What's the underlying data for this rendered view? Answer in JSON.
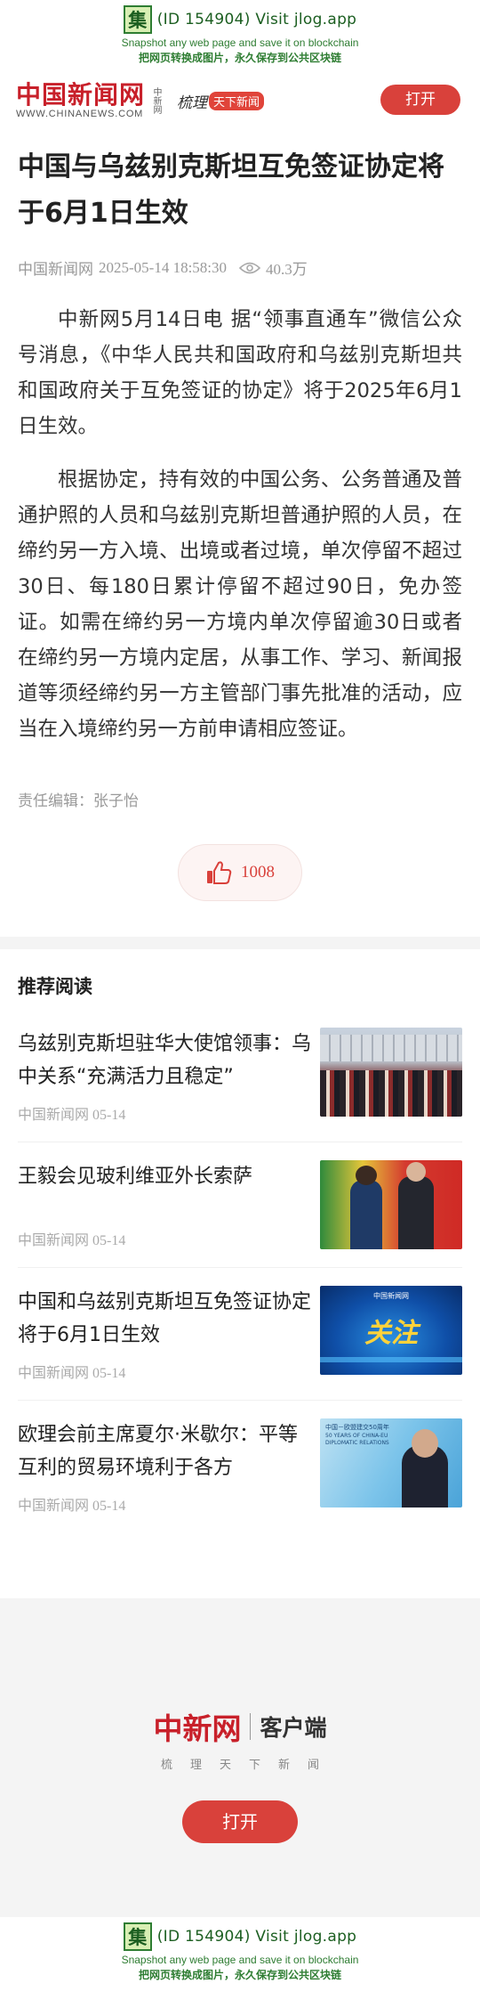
{
  "jlog": {
    "logo_char": "集",
    "main": "(ID 154904) Visit jlog.app",
    "sub_en": "Snapshot any web page and save it on blockchain",
    "sub_cn": "把网页转换成图片，永久保存到公共区块链"
  },
  "header": {
    "brand_cn": "中国新闻网",
    "brand_en": "WWW.CHINANEWS.COM",
    "brand_side": "中新网",
    "slogan_a": "梳理",
    "slogan_b": "天下新闻",
    "open_label": "打开"
  },
  "article": {
    "title": "中国与乌兹别克斯坦互免签证协定将于6月1日生效",
    "source": "中国新闻网",
    "time": "2025-05-14 18:58:30",
    "views": "40.3万",
    "paragraphs": [
      "中新网5月14日电 据“领事直通车”微信公众号消息，《中华人民共和国政府和乌兹别克斯坦共和国政府关于互免签证的协定》将于2025年6月1日生效。",
      "根据协定，持有效的中国公务、公务普通及普通护照的人员和乌兹别克斯坦普通护照的人员，在缔约另一方入境、出境或者过境，单次停留不超过30日、每180日累计停留不超过90日，免办签证。如需在缔约另一方境内单次停留逾30日或者在缔约另一方境内定居，从事工作、学习、新闻报道等须经缔约另一方主管部门事先批准的活动，应当在入境缔约另一方前申请相应签证。"
    ],
    "editor": "责任编辑：张子怡",
    "likes": "1008"
  },
  "recommend": {
    "title": "推荐阅读",
    "items": [
      {
        "headline": "乌兹别克斯坦驻华大使馆领事：乌中关系“充满活力且稳定”",
        "meta": "中国新闻网 05-14",
        "thumb": "group-photo"
      },
      {
        "headline": "王毅会见玻利维亚外长索萨",
        "meta": "中国新闻网 05-14",
        "thumb": "handshake-photo"
      },
      {
        "headline": "中国和乌兹别克斯坦互免签证协定将于6月1日生效",
        "meta": "中国新闻网 05-14",
        "thumb": "guanzhu-graphic"
      },
      {
        "headline": "欧理会前主席夏尔·米歇尔：平等互利的贸易环境利于各方",
        "meta": "中国新闻网 05-14",
        "thumb": "interview-photo"
      }
    ],
    "thumb_caption_3_top": "中国新闻网",
    "thumb_caption_3_main": "关注",
    "thumb_caption_4_cn": "中国－欧盟建交50周年",
    "thumb_caption_4_en": "50 YEARS OF CHINA-EU DIPLOMATIC RELATIONS"
  },
  "footer": {
    "brand_cn": "中新网",
    "client": "客户端",
    "slogan": "梳理天下新闻",
    "open_label": "打开"
  },
  "colors": {
    "brand_red": "#c8202a",
    "button_red": "#d9413b",
    "jlog_green": "#1b5e20"
  }
}
